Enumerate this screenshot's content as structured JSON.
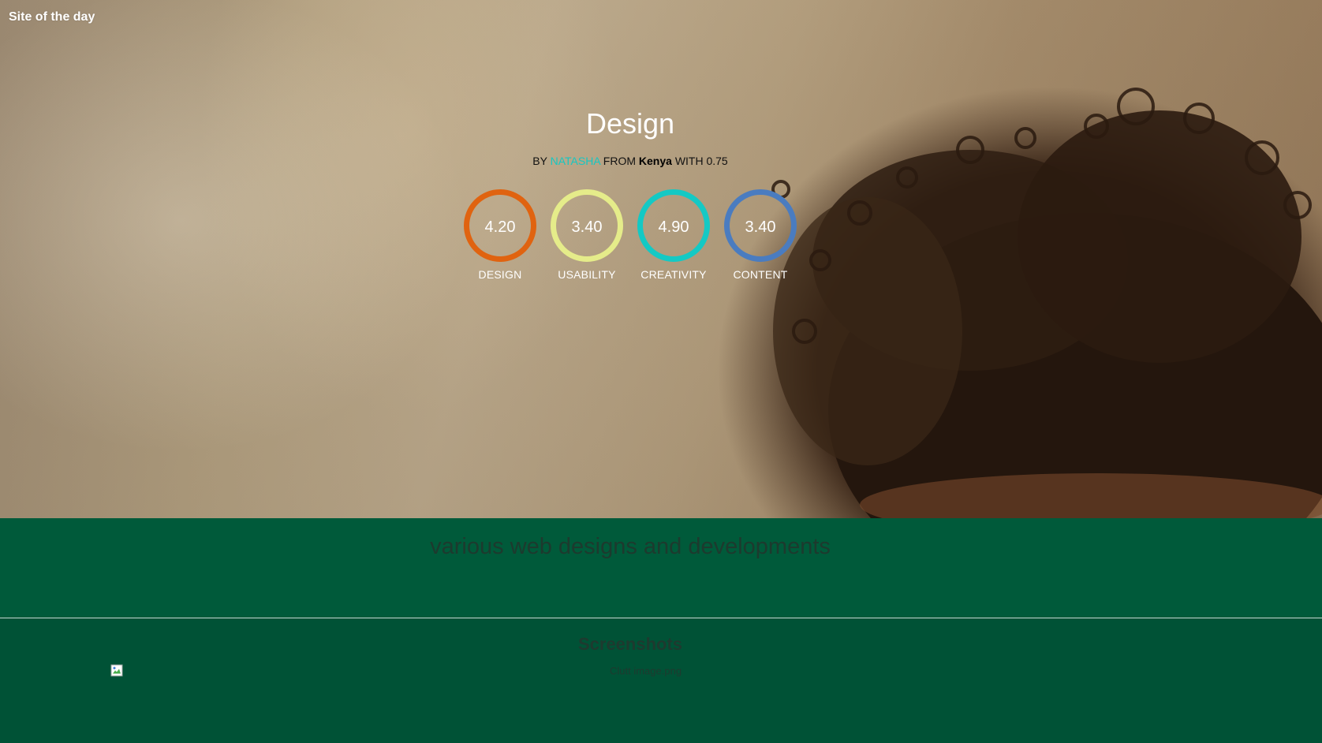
{
  "site_label": "Site of the day",
  "hero": {
    "title": "Design",
    "byline": {
      "by": "BY",
      "author": "NATASHA",
      "from": "FROM",
      "country": "Kenya",
      "with": "WITH 0.75"
    }
  },
  "scores": [
    {
      "value": "4.20",
      "label": "DESIGN",
      "color": "#e06310"
    },
    {
      "value": "3.40",
      "label": "USABILITY",
      "color": "#e5ec8a"
    },
    {
      "value": "4.90",
      "label": "CREATIVITY",
      "color": "#14c9c4"
    },
    {
      "value": "3.40",
      "label": "CONTENT",
      "color": "#4a7cc0"
    }
  ],
  "tagline": "various web designs and developments",
  "screenshots": {
    "title": "Screenshots",
    "image_alt": "Clutt image.png"
  },
  "colors": {
    "accent": "#16c7c2",
    "section_green": "#005a3a",
    "footer_green": "#005236"
  }
}
